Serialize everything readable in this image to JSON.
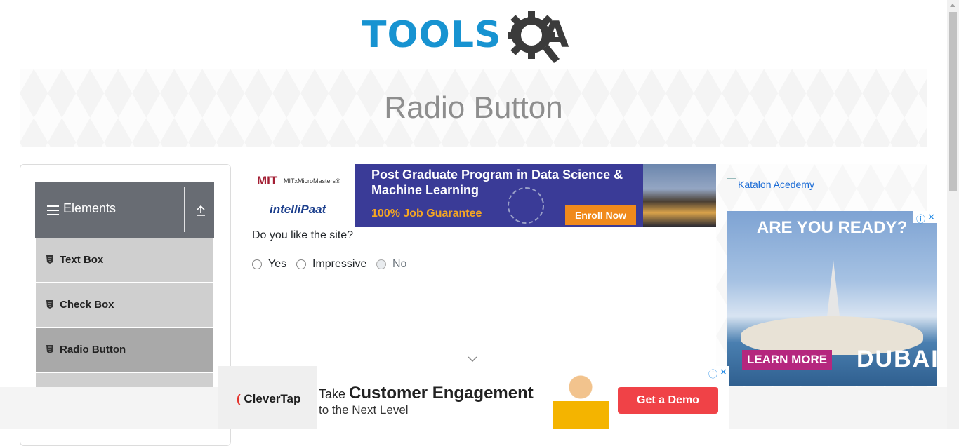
{
  "logo": {
    "part1": "TOOLS",
    "part2": "QA"
  },
  "banner": {
    "title": "Radio Button"
  },
  "sidebar": {
    "group": {
      "label": "Elements"
    },
    "items": [
      {
        "label": "Text Box"
      },
      {
        "label": "Check Box"
      },
      {
        "label": "Radio Button"
      }
    ]
  },
  "ad_top": {
    "brand1": "MIT",
    "brand1_sub": "MITxMicroMasters®",
    "brand2": "intelliPaat",
    "headline": "Post Graduate Program in Data Science & Machine Learning",
    "guarantee": "100% Job Guarantee",
    "cta": "Enroll Now"
  },
  "form": {
    "question": "Do you like the site?",
    "options": [
      {
        "label": "Yes",
        "disabled": false
      },
      {
        "label": "Impressive",
        "disabled": false
      },
      {
        "label": "No",
        "disabled": true
      }
    ]
  },
  "ad_right": {
    "katalon_alt": "Katalon Acedemy",
    "headline": "ARE YOU READY?",
    "cta": "LEARN MORE",
    "brand": "DUBAI"
  },
  "ad_bottom": {
    "brand": "CleverTap",
    "line1_pre": "Take",
    "line1_bold": "Customer Engagement",
    "line2": "to the Next Level",
    "cta": "Get a Demo"
  },
  "colors": {
    "logo_blue": "#1793d1",
    "logo_dark": "#3b3b3b",
    "sidebar_header": "#686c73",
    "menu_item": "#cfcfcf",
    "menu_item_active": "#a9a9a9",
    "cta_orange": "#f08a1c",
    "cta_red": "#f04247"
  }
}
